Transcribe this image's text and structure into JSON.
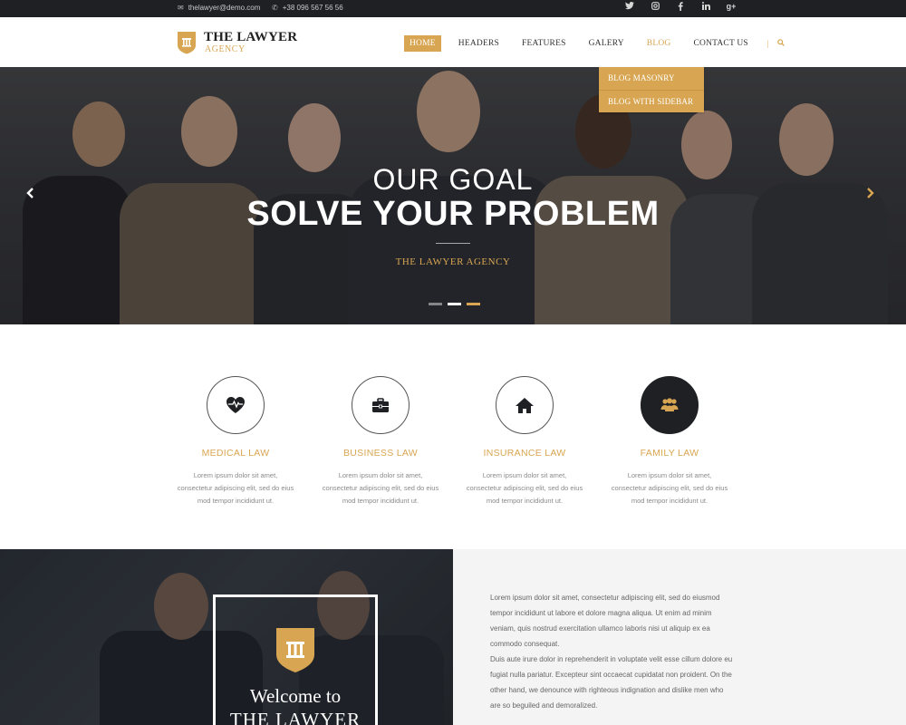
{
  "topbar": {
    "email": "thelawyer@demo.com",
    "phone": "+38 096 567 56 56",
    "socials": [
      "twitter-icon",
      "instagram-icon",
      "facebook-icon",
      "linkedin-icon",
      "google-plus-icon"
    ]
  },
  "brand": {
    "title": "THE LAWYER",
    "subtitle": "AGENCY",
    "accent_color": "#d8a652",
    "dark_color": "#1f2024"
  },
  "nav": {
    "items": [
      "HOME",
      "HEADERS",
      "FEATURES",
      "GALERY",
      "BLOG",
      "CONTACT US"
    ],
    "active": "HOME",
    "highlighted": "BLOG",
    "separator": "|"
  },
  "dropdown": {
    "items": [
      "BLOG MASONRY",
      "BLOG WITH SIDEBAR"
    ]
  },
  "hero": {
    "line1": "OUR GOAL",
    "line2": "SOLVE YOUR PROBLEM",
    "subtitle": "THE LAWYER AGENCY",
    "slide_count": 3,
    "active_slide": 2
  },
  "services": [
    {
      "title": "MEDICAL LAW",
      "icon": "heartbeat-icon",
      "text": [
        "Lorem ipsum dolor sit amet,",
        "consectetur adipiscing elit, sed do eius",
        "mod tempor incididunt ut."
      ]
    },
    {
      "title": "BUSINESS LAW",
      "icon": "briefcase-icon",
      "text": [
        "Lorem ipsum dolor sit amet,",
        "consectetur adipiscing elit, sed do eius",
        "mod tempor incididunt ut."
      ]
    },
    {
      "title": "INSURANCE LAW",
      "icon": "home-icon",
      "text": [
        "Lorem ipsum dolor sit amet,",
        "consectetur adipiscing elit, sed do eius",
        "mod tempor incididunt ut."
      ]
    },
    {
      "title": "FAMILY LAW",
      "icon": "users-icon",
      "text": [
        "Lorem ipsum dolor sit amet,",
        "consectetur adipiscing elit, sed do eius",
        "mod tempor incididunt ut."
      ]
    }
  ],
  "about": {
    "welcome_line1": "Welcome to",
    "welcome_line2": "THE LAWYER",
    "paragraph1": "Lorem ipsum dolor sit amet, consectetur adipiscing elit, sed do eiusmod tempor incididunt ut labore et dolore magna aliqua. Ut enim ad minim veniam, quis nostrud exercitation ullamco laboris nisi ut aliquip ex ea commodo consequat.",
    "paragraph2": "Duis aute irure dolor in reprehenderit in voluptate velit esse cillum dolore eu fugiat nulla pariatur. Excepteur sint occaecat cupidatat non proident. On the other hand, we denounce with righteous indignation and dislike men who are so beguiled and demoralized."
  }
}
